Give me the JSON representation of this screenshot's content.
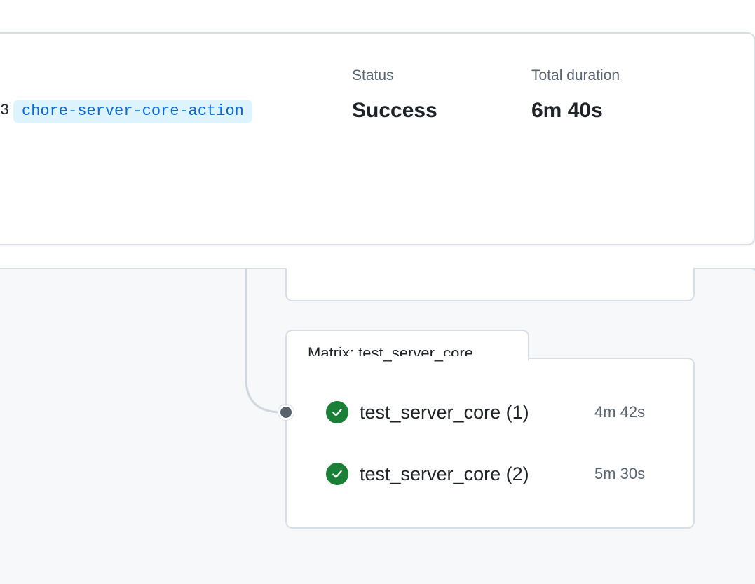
{
  "summary": {
    "branch_prefix": "3",
    "branch_name": "chore-server-core-action",
    "status_label": "Status",
    "status_value": "Success",
    "duration_label": "Total duration",
    "duration_value": "6m 40s"
  },
  "matrix": {
    "title": "Matrix: test_server_core",
    "jobs": [
      {
        "name": "test_server_core (1)",
        "duration": "4m 42s",
        "status": "success",
        "icon": "check-circle-icon"
      },
      {
        "name": "test_server_core (2)",
        "duration": "5m 30s",
        "status": "success",
        "icon": "check-circle-icon"
      }
    ]
  },
  "colors": {
    "success": "#1a7f37",
    "link": "#0969da",
    "pill_bg": "#ddf4ff",
    "canvas_bg": "#f6f8fa",
    "border": "#d8dee4"
  }
}
